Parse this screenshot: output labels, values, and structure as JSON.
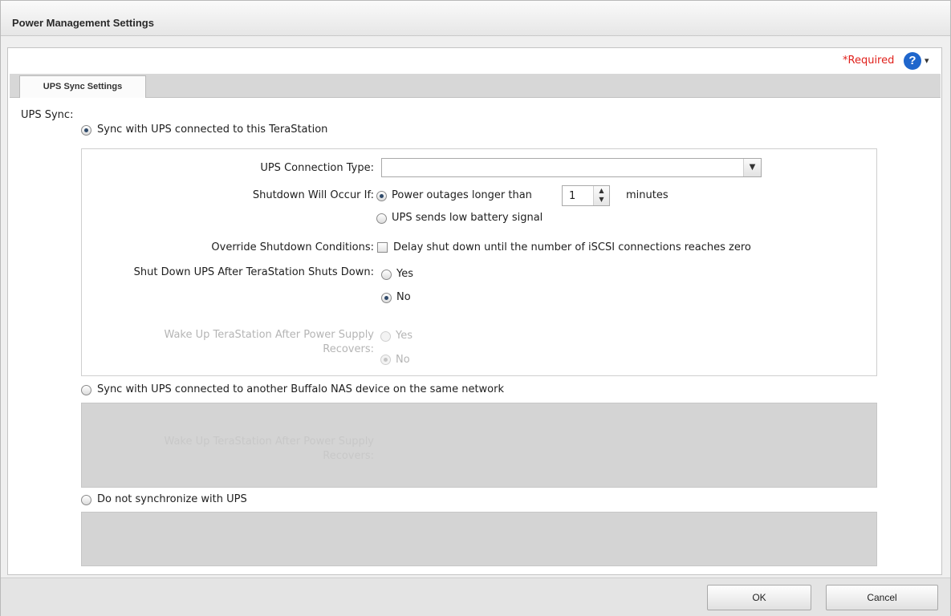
{
  "window": {
    "title": "Power Management Settings"
  },
  "header": {
    "required_label": "*Required",
    "help_icon": "?",
    "help_caret": "▾"
  },
  "tabs": [
    {
      "label": "UPS Sync Settings",
      "selected": true
    }
  ],
  "form": {
    "ups_sync_label": "UPS Sync:",
    "option_local": {
      "label": "Sync with UPS connected to this TeraStation",
      "selected": true
    },
    "connection_type": {
      "label": "UPS Connection Type:",
      "value": ""
    },
    "shutdown": {
      "label": "Shutdown Will Occur If:",
      "power_outage_label": "Power outages longer than",
      "minutes_value": "1",
      "minutes_unit": "minutes",
      "power_outage_selected": true,
      "low_battery_label": "UPS sends low battery signal",
      "low_battery_selected": false
    },
    "override": {
      "label": "Override Shutdown Conditions:",
      "checkbox_label": "Delay shut down until the number of iSCSI connections reaches zero",
      "checked": false
    },
    "shutdown_ups": {
      "label": "Shut Down UPS After TeraStation Shuts Down:",
      "yes_label": "Yes",
      "no_label": "No",
      "value": "No"
    },
    "wake_up": {
      "label_line1": "Wake Up TeraStation After Power Supply",
      "label_line2": "Recovers:",
      "yes_label": "Yes",
      "no_label": "No",
      "value": "No"
    },
    "option_network": {
      "label": "Sync with UPS connected to another Buffalo NAS device on the same network",
      "selected": false,
      "ghost_line1": "Wake Up TeraStation After Power Supply",
      "ghost_line2": "Recovers:"
    },
    "option_none": {
      "label": "Do not synchronize with UPS",
      "selected": false
    }
  },
  "buttons": {
    "ok": "OK",
    "cancel": "Cancel"
  }
}
